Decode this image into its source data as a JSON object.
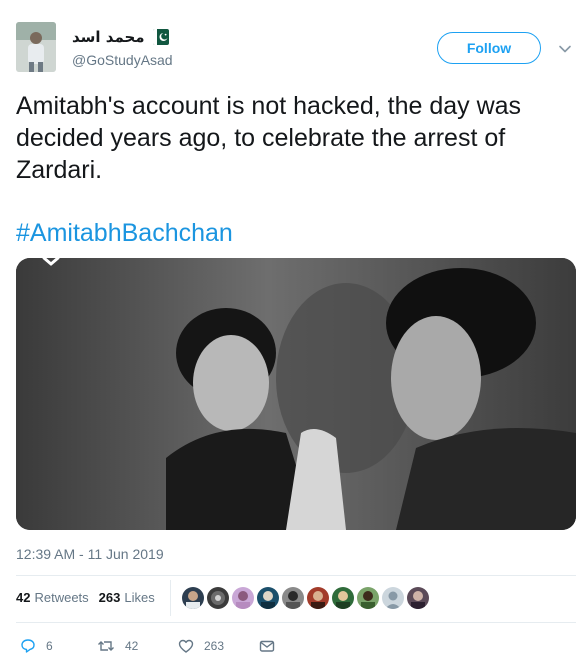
{
  "user": {
    "display_name": "محمد اسد",
    "handle": "@GoStudyAsad",
    "flag_icon": "pakistan-flag-icon"
  },
  "follow_button": {
    "label": "Follow"
  },
  "tweet": {
    "text": "Amitabh's account is not hacked, the day was decided years ago, to celebrate the arrest of Zardari.",
    "hashtag": "#AmitabhBachchan",
    "timestamp": "12:39 AM - 11 Jun 2019"
  },
  "stats": {
    "retweets_count": "42",
    "retweets_label": "Retweets",
    "likes_count": "263",
    "likes_label": "Likes"
  },
  "actions": {
    "reply_count": "6",
    "retweet_count": "42",
    "like_count": "263"
  },
  "colors": {
    "accent": "#1da1f2",
    "hashtag": "#1b95e0",
    "muted": "#657786",
    "text": "#14171a"
  }
}
